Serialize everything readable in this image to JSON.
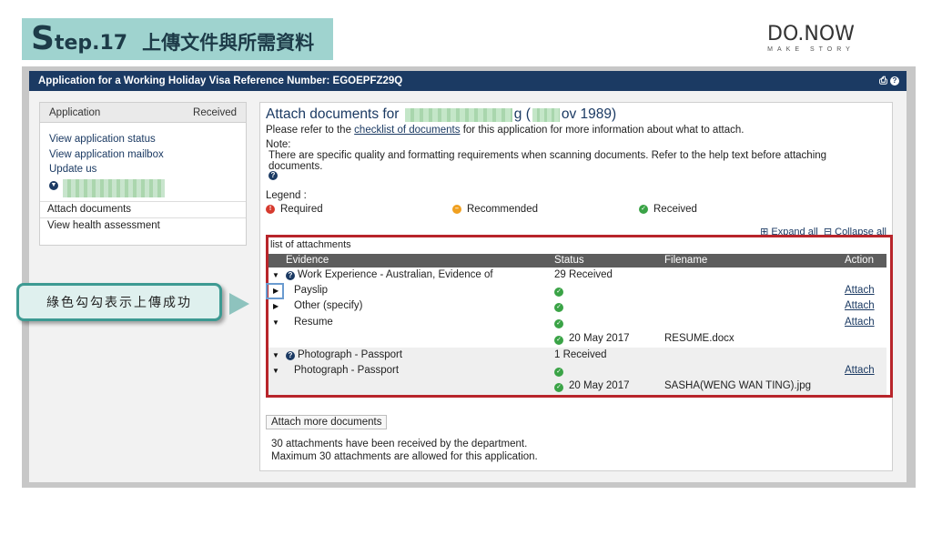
{
  "banner": {
    "step_letter": "S",
    "step_num": "tep.17",
    "title": "上傳文件與所需資料"
  },
  "brand": {
    "name": "DO.NOW",
    "tagline": "MAKE STORY"
  },
  "appbar": {
    "title": "Application for a Working Holiday Visa Reference Number: EGOEPFZ29Q",
    "icons": [
      "print-icon",
      "help-icon"
    ]
  },
  "sidebar": {
    "header_label": "Application",
    "header_status": "Received",
    "links": [
      "View application status",
      "View application mailbox",
      "Update us"
    ],
    "sub_items": [
      "Attach documents",
      "View health assessment"
    ]
  },
  "main": {
    "title_prefix": "Attach documents for",
    "title_mid": "g (",
    "title_suffix": "ov 1989)",
    "intro_before": "Please refer to the ",
    "intro_link": "checklist of documents",
    "intro_after": " for this application for more information about what to attach.",
    "note_label": "Note:",
    "note_text": "There are specific quality and formatting requirements when scanning documents. Refer to the help text before attaching documents.",
    "legend_label": "Legend :",
    "legend": [
      {
        "label": "Required",
        "color": "#d63a2e"
      },
      {
        "label": "Recommended",
        "color": "#f0a020"
      },
      {
        "label": "Received",
        "color": "#3aa346"
      }
    ],
    "expand_all": "Expand all",
    "collapse_all": "Collapse all"
  },
  "attachments": {
    "caption": "list of attachments",
    "columns": [
      "Evidence",
      "Status",
      "Filename",
      "Action"
    ],
    "rows": [
      {
        "evidence": "Work Experience - Australian, Evidence of",
        "status": "29 Received",
        "filename": "",
        "action": ""
      },
      {
        "evidence": "Payslip",
        "status": "",
        "filename": "",
        "action": "Attach"
      },
      {
        "evidence": "Other (specify)",
        "status": "",
        "filename": "",
        "action": "Attach"
      },
      {
        "evidence": "Resume",
        "status": "",
        "filename": "",
        "action": "Attach"
      },
      {
        "evidence": "",
        "status": "20 May 2017",
        "filename": "RESUME.docx",
        "action": ""
      },
      {
        "evidence": "Photograph - Passport",
        "status": "1 Received",
        "filename": "",
        "action": ""
      },
      {
        "evidence": "Photograph - Passport",
        "status": "",
        "filename": "",
        "action": "Attach"
      },
      {
        "evidence": "",
        "status": "20 May 2017",
        "filename": "SASHA(WENG WAN TING).jpg",
        "action": ""
      }
    ]
  },
  "actions": {
    "more_button": "Attach more documents",
    "summary_line1": "30 attachments have been received by the department.",
    "summary_line2": "Maximum 30 attachments are allowed for this application."
  },
  "callout": {
    "text": "綠色勾勾表示上傳成功"
  }
}
